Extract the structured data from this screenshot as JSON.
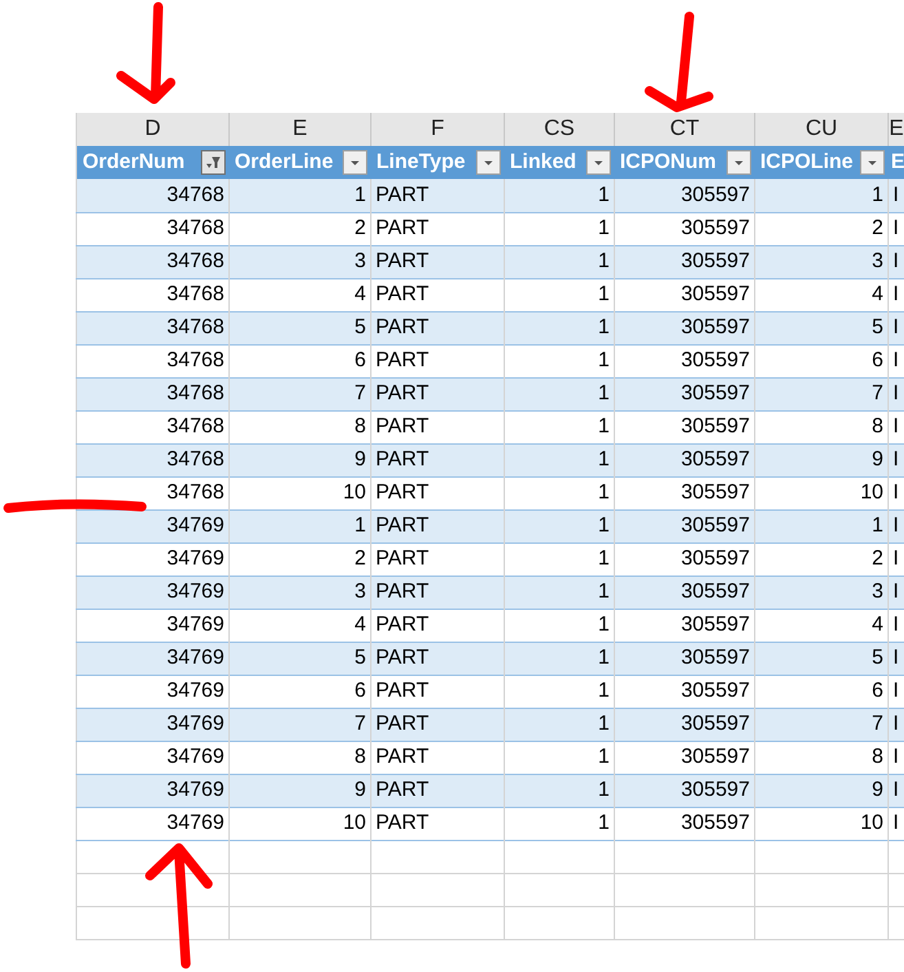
{
  "column_letters": [
    "D",
    "E",
    "F",
    "CS",
    "CT",
    "CU",
    "E"
  ],
  "columns": [
    {
      "name": "OrderNum",
      "kind": "number",
      "filtered": true
    },
    {
      "name": "OrderLine",
      "kind": "number",
      "filtered": false
    },
    {
      "name": "LineType",
      "kind": "text",
      "filtered": false
    },
    {
      "name": "Linked",
      "kind": "number",
      "filtered": false
    },
    {
      "name": "ICPONum",
      "kind": "number",
      "filtered": false
    },
    {
      "name": "ICPOLine",
      "kind": "number",
      "filtered": false
    },
    {
      "name": "E",
      "kind": "partial"
    }
  ],
  "rows": [
    [
      "34768",
      "1",
      "PART",
      "1",
      "305597",
      "1",
      "I"
    ],
    [
      "34768",
      "2",
      "PART",
      "1",
      "305597",
      "2",
      "I"
    ],
    [
      "34768",
      "3",
      "PART",
      "1",
      "305597",
      "3",
      "I"
    ],
    [
      "34768",
      "4",
      "PART",
      "1",
      "305597",
      "4",
      "I"
    ],
    [
      "34768",
      "5",
      "PART",
      "1",
      "305597",
      "5",
      "I"
    ],
    [
      "34768",
      "6",
      "PART",
      "1",
      "305597",
      "6",
      "I"
    ],
    [
      "34768",
      "7",
      "PART",
      "1",
      "305597",
      "7",
      "I"
    ],
    [
      "34768",
      "8",
      "PART",
      "1",
      "305597",
      "8",
      "I"
    ],
    [
      "34768",
      "9",
      "PART",
      "1",
      "305597",
      "9",
      "I"
    ],
    [
      "34768",
      "10",
      "PART",
      "1",
      "305597",
      "10",
      "I"
    ],
    [
      "34769",
      "1",
      "PART",
      "1",
      "305597",
      "1",
      "I"
    ],
    [
      "34769",
      "2",
      "PART",
      "1",
      "305597",
      "2",
      "I"
    ],
    [
      "34769",
      "3",
      "PART",
      "1",
      "305597",
      "3",
      "I"
    ],
    [
      "34769",
      "4",
      "PART",
      "1",
      "305597",
      "4",
      "I"
    ],
    [
      "34769",
      "5",
      "PART",
      "1",
      "305597",
      "5",
      "I"
    ],
    [
      "34769",
      "6",
      "PART",
      "1",
      "305597",
      "6",
      "I"
    ],
    [
      "34769",
      "7",
      "PART",
      "1",
      "305597",
      "7",
      "I"
    ],
    [
      "34769",
      "8",
      "PART",
      "1",
      "305597",
      "8",
      "I"
    ],
    [
      "34769",
      "9",
      "PART",
      "1",
      "305597",
      "9",
      "I"
    ],
    [
      "34769",
      "10",
      "PART",
      "1",
      "305597",
      "10",
      "I"
    ]
  ]
}
